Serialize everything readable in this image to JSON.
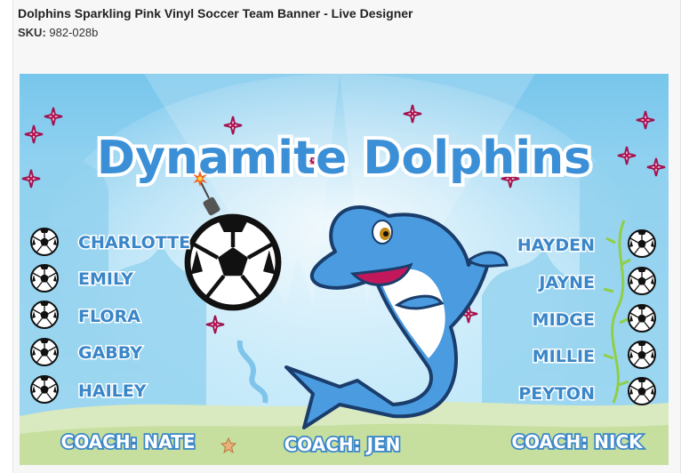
{
  "header": {
    "product_title": "Dolphins Sparkling Pink Vinyl Soccer Team Banner - Live Designer",
    "sku_label": "SKU:",
    "sku_value": "982-028b"
  },
  "banner": {
    "team_name": "Dynamite Dolphins",
    "players_left": [
      "CHARLOTTE",
      "EMILY",
      "FLORA",
      "GABBY",
      "HAILEY"
    ],
    "players_right": [
      "HAYDEN",
      "JAYNE",
      "MIDGE",
      "MILLIE",
      "PEYTON"
    ],
    "coaches": [
      "COACH: NATE",
      "COACH: JEN",
      "COACH: NICK"
    ],
    "colors": {
      "sky_top": "#7cc8ec",
      "sky_bottom": "#c9ecfb",
      "title_fill": "#3a8fd6",
      "name_fill": "#3a86c8",
      "coach_fill": "#ffffff",
      "sparkle": "#b0125f",
      "sand": "#d9e9c0"
    },
    "icons": [
      "soccer-ball-icon",
      "bomb-fuse-icon",
      "dolphin-mascot",
      "sparkle-icon",
      "starfish-icon",
      "seaweed-icon"
    ]
  }
}
